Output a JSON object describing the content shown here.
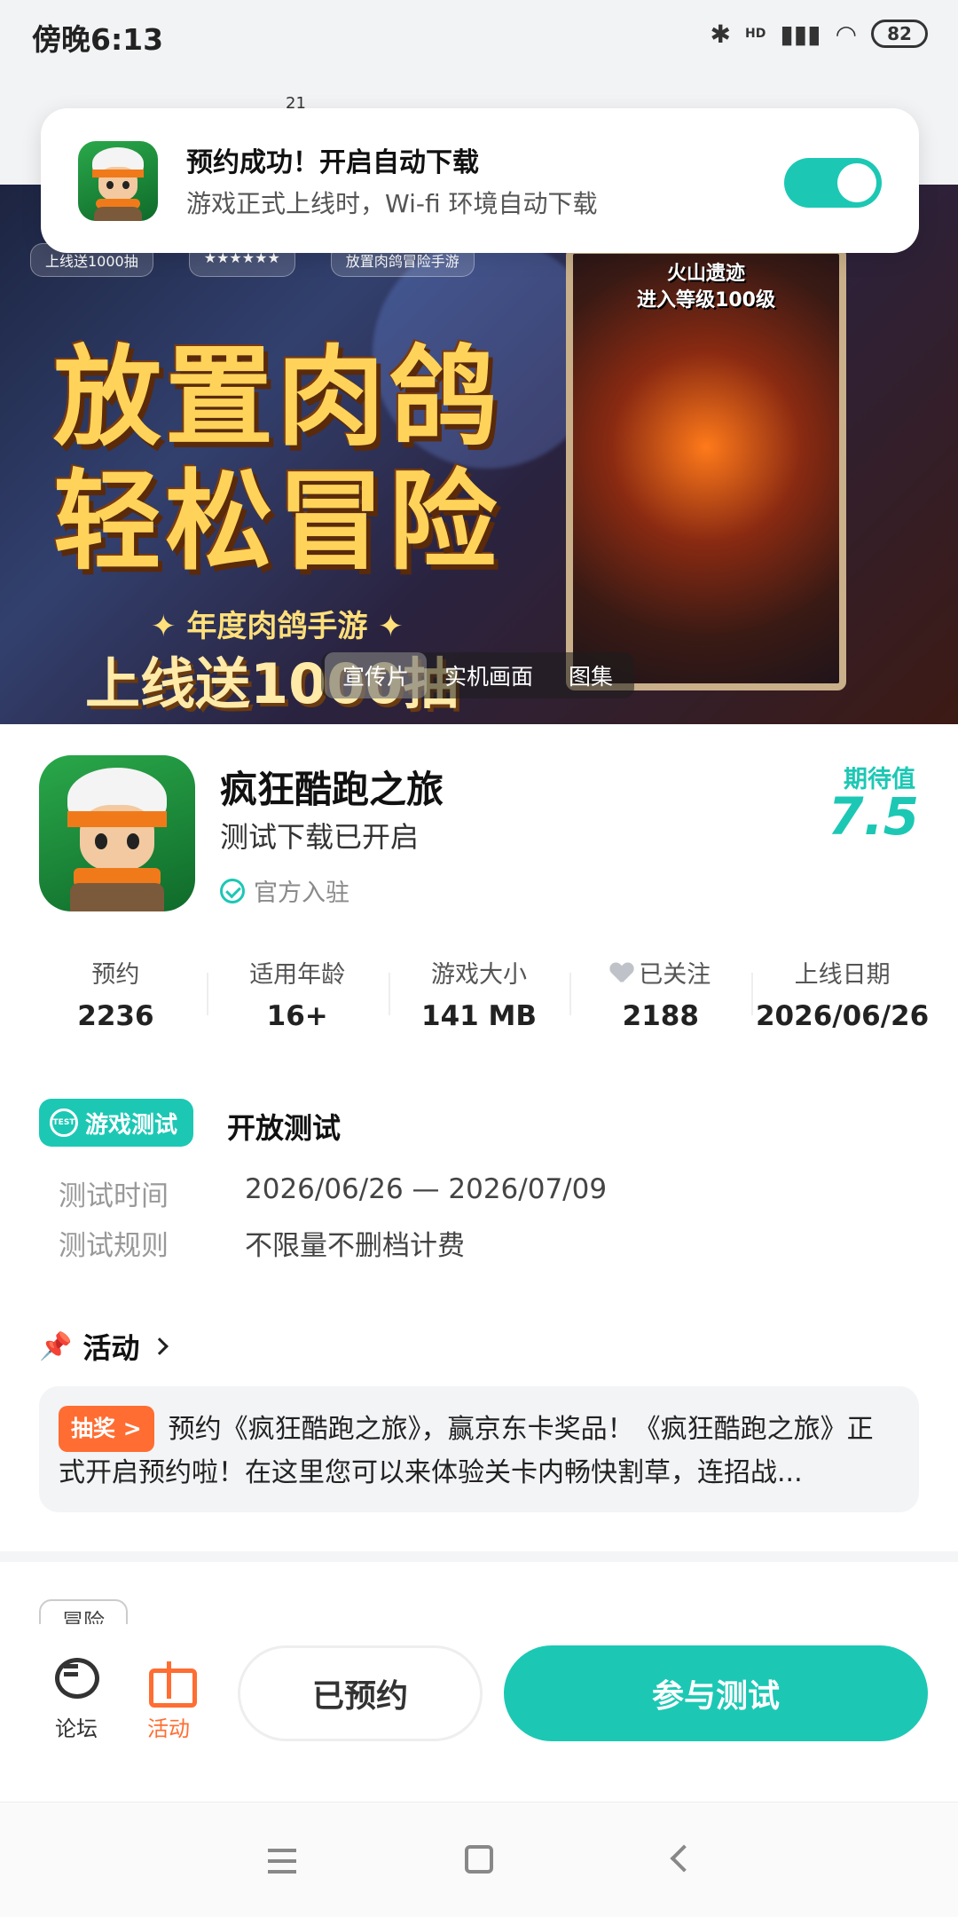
{
  "status_bar": {
    "time": "傍晚6:13",
    "battery": "82",
    "network": "HD"
  },
  "topbar_fragment": "21",
  "notification": {
    "title": "预约成功！开启自动下载",
    "subtitle": "游戏正式上线时，Wi-fi 环境自动下载",
    "toggle_on": true
  },
  "banner": {
    "badges": [
      "上线送1000抽",
      "★★★★★★",
      "放置肉鸽冒险手游"
    ],
    "title_line1": "放置肉鸽",
    "title_line2": "轻松冒险",
    "subtitle": "✦ 年度肉鸽手游 ✦",
    "bottom": "上线送1000抽",
    "card_line1": "火山遗迹",
    "card_line2": "进入等级100级",
    "media_tabs": [
      "宣传片",
      "实机画面",
      "图集"
    ],
    "active_tab": "宣传片"
  },
  "app": {
    "name": "疯狂酷跑之旅",
    "status": "测试下载已开启",
    "verified": "官方入驻",
    "expect_label": "期待值",
    "expect_value": "7.5"
  },
  "stats": [
    {
      "label": "预约",
      "value": "2236"
    },
    {
      "label": "适用年龄",
      "value": "16+"
    },
    {
      "label": "游戏大小",
      "value": "141 MB"
    },
    {
      "label": "已关注",
      "value": "2188"
    },
    {
      "label": "上线日期",
      "value": "2026/06/26"
    }
  ],
  "test": {
    "tag": "游戏测试",
    "title": "开放测试",
    "rows": [
      {
        "key": "测试时间",
        "value": "2026/06/26 — 2026/07/09"
      },
      {
        "key": "测试规则",
        "value": "不限量不删档计费"
      }
    ]
  },
  "activity": {
    "header": "活动",
    "tag": "抽奖 >",
    "text": "预约《疯狂酷跑之旅》，赢京东卡奖品！《疯狂酷跑之旅》正式开启预约啦！在这里您可以来体验关卡内畅快割草，连招战..."
  },
  "genre_tag": "冒险",
  "action_bar": {
    "forum": "论坛",
    "activity": "活动",
    "reserved": "已预约",
    "join": "参与测试"
  },
  "colors": {
    "accent": "#1cc8b4",
    "orange": "#ff6d32"
  }
}
